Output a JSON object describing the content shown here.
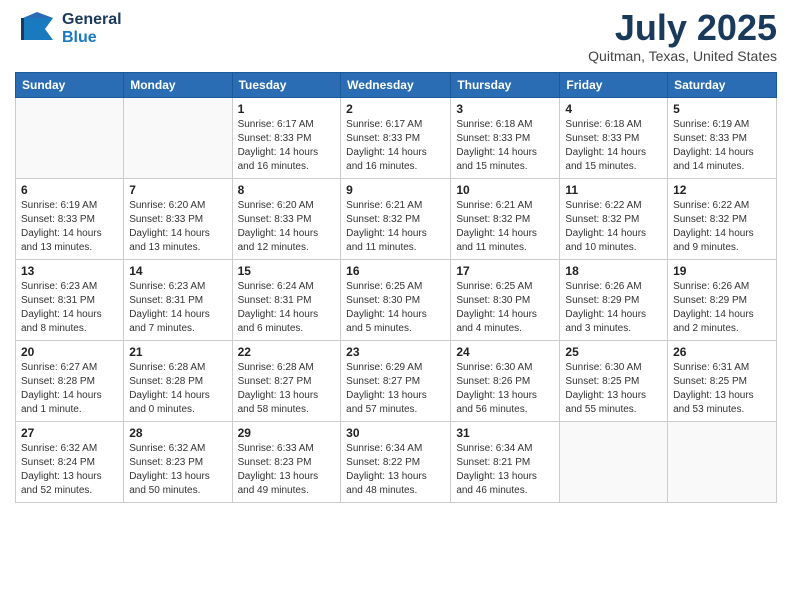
{
  "header": {
    "logo_general": "General",
    "logo_blue": "Blue",
    "month_title": "July 2025",
    "location": "Quitman, Texas, United States"
  },
  "days_of_week": [
    "Sunday",
    "Monday",
    "Tuesday",
    "Wednesday",
    "Thursday",
    "Friday",
    "Saturday"
  ],
  "weeks": [
    [
      {
        "day": "",
        "info": ""
      },
      {
        "day": "",
        "info": ""
      },
      {
        "day": "1",
        "info": "Sunrise: 6:17 AM\nSunset: 8:33 PM\nDaylight: 14 hours and 16 minutes."
      },
      {
        "day": "2",
        "info": "Sunrise: 6:17 AM\nSunset: 8:33 PM\nDaylight: 14 hours and 16 minutes."
      },
      {
        "day": "3",
        "info": "Sunrise: 6:18 AM\nSunset: 8:33 PM\nDaylight: 14 hours and 15 minutes."
      },
      {
        "day": "4",
        "info": "Sunrise: 6:18 AM\nSunset: 8:33 PM\nDaylight: 14 hours and 15 minutes."
      },
      {
        "day": "5",
        "info": "Sunrise: 6:19 AM\nSunset: 8:33 PM\nDaylight: 14 hours and 14 minutes."
      }
    ],
    [
      {
        "day": "6",
        "info": "Sunrise: 6:19 AM\nSunset: 8:33 PM\nDaylight: 14 hours and 13 minutes."
      },
      {
        "day": "7",
        "info": "Sunrise: 6:20 AM\nSunset: 8:33 PM\nDaylight: 14 hours and 13 minutes."
      },
      {
        "day": "8",
        "info": "Sunrise: 6:20 AM\nSunset: 8:33 PM\nDaylight: 14 hours and 12 minutes."
      },
      {
        "day": "9",
        "info": "Sunrise: 6:21 AM\nSunset: 8:32 PM\nDaylight: 14 hours and 11 minutes."
      },
      {
        "day": "10",
        "info": "Sunrise: 6:21 AM\nSunset: 8:32 PM\nDaylight: 14 hours and 11 minutes."
      },
      {
        "day": "11",
        "info": "Sunrise: 6:22 AM\nSunset: 8:32 PM\nDaylight: 14 hours and 10 minutes."
      },
      {
        "day": "12",
        "info": "Sunrise: 6:22 AM\nSunset: 8:32 PM\nDaylight: 14 hours and 9 minutes."
      }
    ],
    [
      {
        "day": "13",
        "info": "Sunrise: 6:23 AM\nSunset: 8:31 PM\nDaylight: 14 hours and 8 minutes."
      },
      {
        "day": "14",
        "info": "Sunrise: 6:23 AM\nSunset: 8:31 PM\nDaylight: 14 hours and 7 minutes."
      },
      {
        "day": "15",
        "info": "Sunrise: 6:24 AM\nSunset: 8:31 PM\nDaylight: 14 hours and 6 minutes."
      },
      {
        "day": "16",
        "info": "Sunrise: 6:25 AM\nSunset: 8:30 PM\nDaylight: 14 hours and 5 minutes."
      },
      {
        "day": "17",
        "info": "Sunrise: 6:25 AM\nSunset: 8:30 PM\nDaylight: 14 hours and 4 minutes."
      },
      {
        "day": "18",
        "info": "Sunrise: 6:26 AM\nSunset: 8:29 PM\nDaylight: 14 hours and 3 minutes."
      },
      {
        "day": "19",
        "info": "Sunrise: 6:26 AM\nSunset: 8:29 PM\nDaylight: 14 hours and 2 minutes."
      }
    ],
    [
      {
        "day": "20",
        "info": "Sunrise: 6:27 AM\nSunset: 8:28 PM\nDaylight: 14 hours and 1 minute."
      },
      {
        "day": "21",
        "info": "Sunrise: 6:28 AM\nSunset: 8:28 PM\nDaylight: 14 hours and 0 minutes."
      },
      {
        "day": "22",
        "info": "Sunrise: 6:28 AM\nSunset: 8:27 PM\nDaylight: 13 hours and 58 minutes."
      },
      {
        "day": "23",
        "info": "Sunrise: 6:29 AM\nSunset: 8:27 PM\nDaylight: 13 hours and 57 minutes."
      },
      {
        "day": "24",
        "info": "Sunrise: 6:30 AM\nSunset: 8:26 PM\nDaylight: 13 hours and 56 minutes."
      },
      {
        "day": "25",
        "info": "Sunrise: 6:30 AM\nSunset: 8:25 PM\nDaylight: 13 hours and 55 minutes."
      },
      {
        "day": "26",
        "info": "Sunrise: 6:31 AM\nSunset: 8:25 PM\nDaylight: 13 hours and 53 minutes."
      }
    ],
    [
      {
        "day": "27",
        "info": "Sunrise: 6:32 AM\nSunset: 8:24 PM\nDaylight: 13 hours and 52 minutes."
      },
      {
        "day": "28",
        "info": "Sunrise: 6:32 AM\nSunset: 8:23 PM\nDaylight: 13 hours and 50 minutes."
      },
      {
        "day": "29",
        "info": "Sunrise: 6:33 AM\nSunset: 8:23 PM\nDaylight: 13 hours and 49 minutes."
      },
      {
        "day": "30",
        "info": "Sunrise: 6:34 AM\nSunset: 8:22 PM\nDaylight: 13 hours and 48 minutes."
      },
      {
        "day": "31",
        "info": "Sunrise: 6:34 AM\nSunset: 8:21 PM\nDaylight: 13 hours and 46 minutes."
      },
      {
        "day": "",
        "info": ""
      },
      {
        "day": "",
        "info": ""
      }
    ]
  ]
}
